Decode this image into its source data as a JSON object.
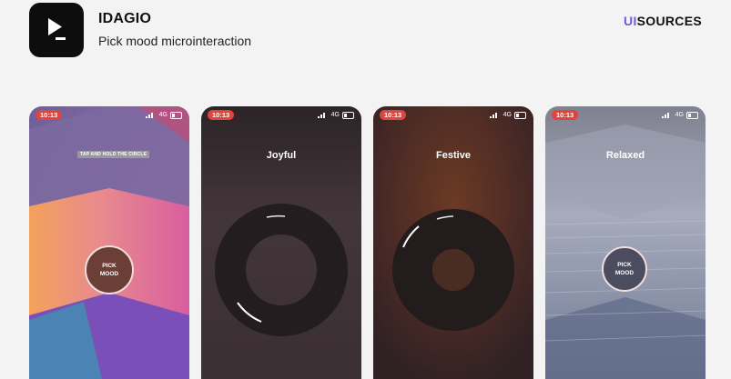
{
  "app": {
    "title": "IDAGIO",
    "subtitle": "Pick mood microinteraction",
    "icon": "play-cursor-icon"
  },
  "brand": {
    "prefix": "UI",
    "suffix": "SOURCES",
    "accent": "#6d5ce8"
  },
  "status_bar": {
    "time": "10:13",
    "network": "4G",
    "time_color": "#e0453b"
  },
  "screens": [
    {
      "hint": "TAP AND HOLD THE CIRCLE",
      "button_line1": "PICK",
      "button_line2": "MOOD"
    },
    {
      "mood": "Joyful"
    },
    {
      "mood": "Festive"
    },
    {
      "mood": "Relaxed",
      "button_line1": "PICK",
      "button_line2": "MOOD"
    }
  ]
}
